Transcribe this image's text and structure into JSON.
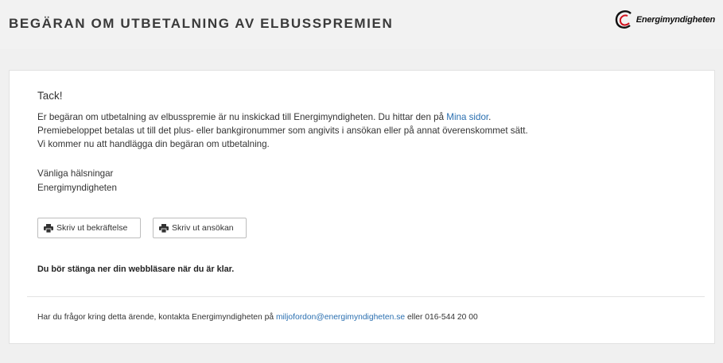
{
  "header": {
    "title": "BEGÄRAN OM UTBETALNING AV ELBUSSPREMIEN",
    "logo_text": "Energimyndigheten"
  },
  "content": {
    "thanks": "Tack!",
    "message_line1_before_link": "Er begäran om utbetalning av elbusspremie är nu inskickad till Energimyndigheten. Du hittar den på ",
    "message_link": "Mina sidor",
    "message_line1_after_link": ".",
    "message_line2": "Premiebeloppet betalas ut till det plus- eller bankgironummer som angivits i ansökan eller på annat överenskommet sätt.",
    "message_line3": "Vi kommer nu att handlägga din begäran om utbetalning.",
    "signoff_greeting": "Vänliga hälsningar",
    "signoff_name": "Energimyndigheten",
    "print_confirmation_label": "Skriv ut bekräftelse",
    "print_application_label": "Skriv ut ansökan",
    "close_notice": "Du bör stänga ner din webbläsare när du är klar."
  },
  "footer": {
    "text_before_email": "Har du frågor kring detta ärende, kontakta Energimyndigheten på ",
    "email": "miljofordon@energimyndigheten.se",
    "text_after_email": " eller 016-544 20 00"
  },
  "colors": {
    "link": "#2a6fb0",
    "logo_accent": "#d0101c"
  },
  "icons": {
    "print": "printer-icon",
    "logo": "energimyndigheten-logo-icon"
  }
}
